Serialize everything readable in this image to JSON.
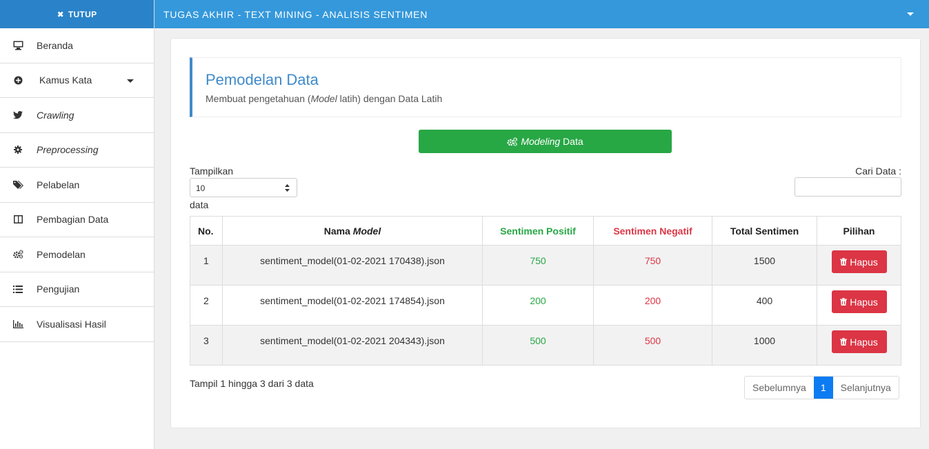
{
  "sidebar": {
    "close_label": "TUTUP",
    "items": [
      {
        "label": "Beranda",
        "icon": "monitor-icon"
      },
      {
        "label": "Kamus Kata",
        "icon": "plus-circle-icon"
      },
      {
        "label": "Crawling",
        "icon": "twitter-icon"
      },
      {
        "label": "Preprocessing",
        "icon": "gear-icon"
      },
      {
        "label": "Pelabelan",
        "icon": "tags-icon"
      },
      {
        "label": "Pembagian Data",
        "icon": "columns-icon"
      },
      {
        "label": "Pemodelan",
        "icon": "gears-icon"
      },
      {
        "label": "Pengujian",
        "icon": "list-icon"
      },
      {
        "label": "Visualisasi Hasil",
        "icon": "bar-chart-icon"
      }
    ]
  },
  "topbar": {
    "title": "TUGAS AKHIR - TEXT MINING - ANALISIS SENTIMEN"
  },
  "header": {
    "title": "Pemodelan Data",
    "subtitle_pre": "Membuat pengetahuan (",
    "subtitle_italic": "Model",
    "subtitle_post": " latih) dengan Data Latih"
  },
  "modeling_button": {
    "italic": "Modeling",
    "rest": " Data"
  },
  "table_controls": {
    "length_label": "Tampilkan",
    "length_value": "10",
    "length_suffix": "data",
    "search_label": "Cari Data :",
    "search_value": ""
  },
  "table": {
    "headers": {
      "no": "No.",
      "name_pre": "Nama ",
      "name_italic": "Model",
      "positive": "Sentimen Positif",
      "negative": "Sentimen Negatif",
      "total": "Total Sentimen",
      "options": "Pilihan"
    },
    "delete_label": "Hapus",
    "rows": [
      {
        "no": "1",
        "name": "sentiment_model(01-02-2021 170438).json",
        "positive": "750",
        "negative": "750",
        "total": "1500"
      },
      {
        "no": "2",
        "name": "sentiment_model(01-02-2021 174854).json",
        "positive": "200",
        "negative": "200",
        "total": "400"
      },
      {
        "no": "3",
        "name": "sentiment_model(01-02-2021 204343).json",
        "positive": "500",
        "negative": "500",
        "total": "1000"
      }
    ]
  },
  "footer": {
    "info": "Tampil 1 hingga 3 dari 3 data",
    "prev": "Sebelumnya",
    "page": "1",
    "next": "Selanjutnya"
  },
  "colors": {
    "topbar": "#3498db",
    "sidebar_top": "#2a83c8",
    "positive": "#28a745",
    "negative": "#dc3545",
    "accent": "#3f8ac9"
  }
}
